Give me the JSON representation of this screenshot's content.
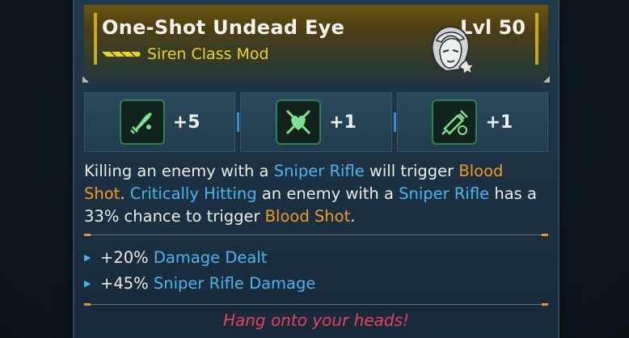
{
  "item": {
    "name": "One-Shot Undead Eye",
    "level": "Lvl 50",
    "type": "Siren Class Mod",
    "rarity_icon": "rarity-chevrons-icon",
    "character_icon": "siren-portrait-icon"
  },
  "stats": [
    {
      "icon": "sniper-projectile-icon",
      "value": "+5"
    },
    {
      "icon": "crossed-heart-icon",
      "value": "+1"
    },
    {
      "icon": "syringe-timer-icon",
      "value": "+1"
    }
  ],
  "description": {
    "p1": "Killing an enemy with a ",
    "k1": "Sniper Rifle",
    "p2": " will trigger ",
    "k2": "Blood Shot",
    "p3": ". ",
    "k3": "Critically Hitting",
    "p4": " an enemy with a ",
    "k4": "Sniper Rifle",
    "p5": " has a 33% chance to trigger ",
    "k5": "Blood Shot",
    "p6": "."
  },
  "bonuses": [
    {
      "value": "+20% ",
      "label": "Damage Dealt"
    },
    {
      "value": "+45% ",
      "label": "Sniper Rifle Damage"
    }
  ],
  "flavor_text": "Hang onto your heads!",
  "colors": {
    "rarity_gold": "#f0d320",
    "keyword_blue": "#4bb4ee",
    "keyword_orange": "#f09a22",
    "flavor_red": "#e9415d"
  }
}
